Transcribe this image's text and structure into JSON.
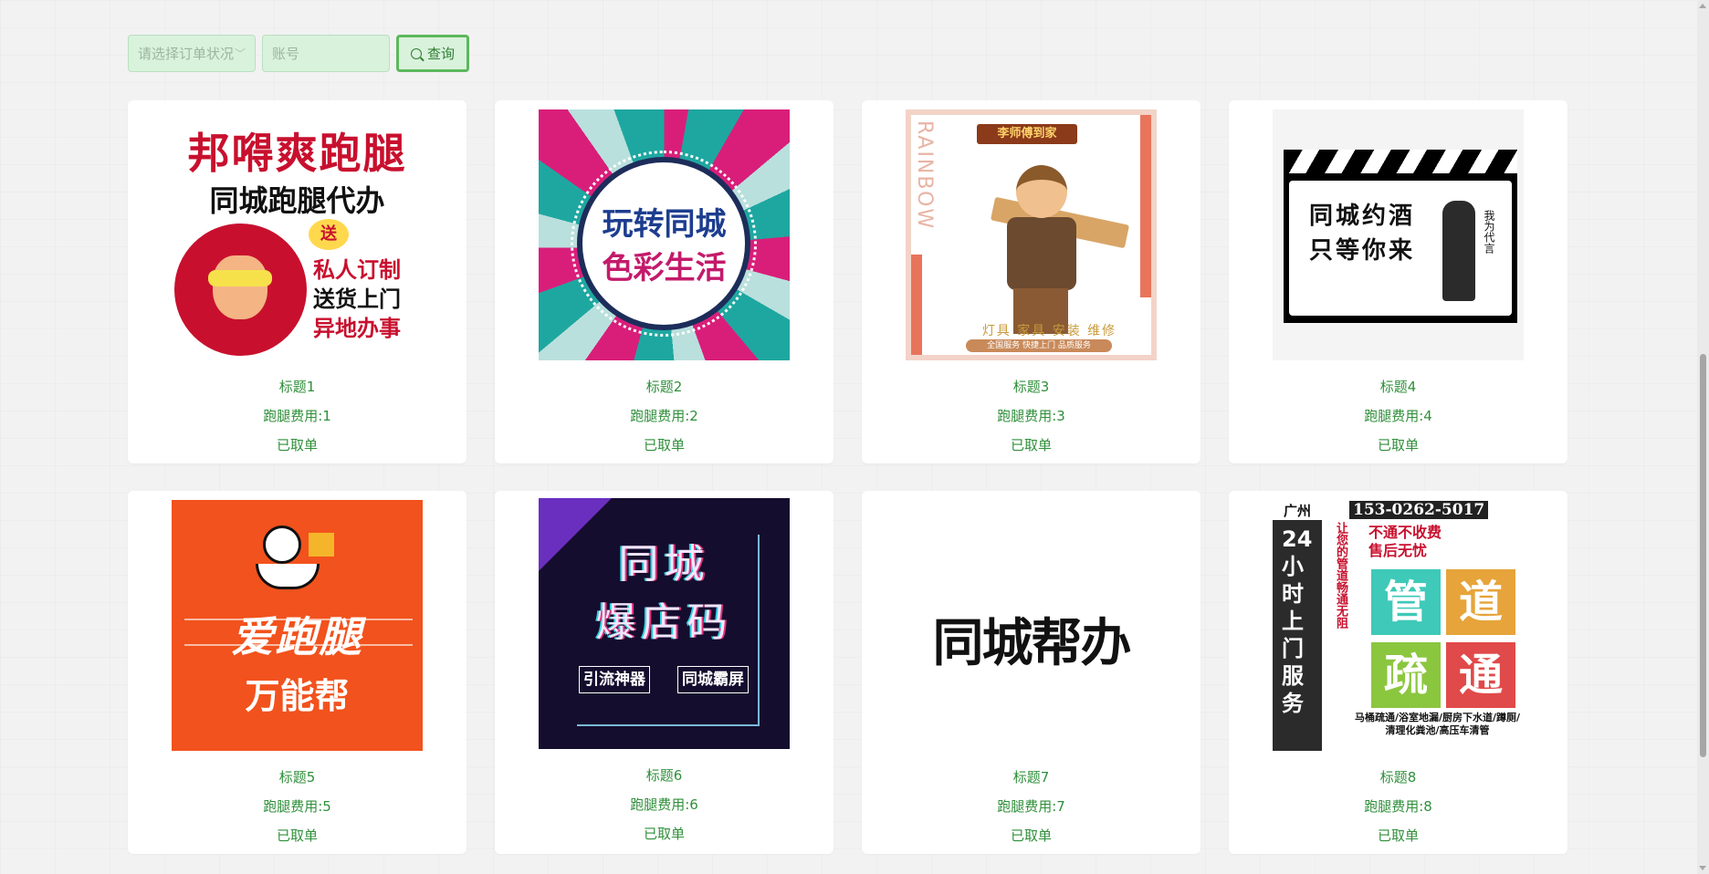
{
  "toolbar": {
    "status_placeholder": "请选择订单状况",
    "account_placeholder": "账号",
    "query_label": "查询"
  },
  "cards": [
    {
      "title": "标题1",
      "fee": "跑腿费用:1",
      "status": "已取单",
      "image_text": {
        "h1": "邦嘚爽跑腿",
        "h2": "同城跑腿代办",
        "badge": "送",
        "l1": "私人订制",
        "l2": "送货上门",
        "l3": "异地办事"
      }
    },
    {
      "title": "标题2",
      "fee": "跑腿费用:2",
      "status": "已取单",
      "image_text": {
        "l1": "玩转同城",
        "l2": "色彩生活"
      }
    },
    {
      "title": "标题3",
      "fee": "跑腿费用:3",
      "status": "已取单",
      "image_text": {
        "banner": "李师傅到家",
        "side": "RAINBOW",
        "caption": "灯具 家具 安装 维修",
        "sub": "全国服务 快捷上门 品质服务"
      }
    },
    {
      "title": "标题4",
      "fee": "跑腿费用:4",
      "status": "已取单",
      "image_text": {
        "l1": "同城约酒",
        "l2": "只等你来",
        "side": "我为代言"
      }
    },
    {
      "title": "标题5",
      "fee": "跑腿费用:5",
      "status": "已取单",
      "image_text": {
        "big": "爱跑腿",
        "small": "万能帮"
      }
    },
    {
      "title": "标题6",
      "fee": "跑腿费用:6",
      "status": "已取单",
      "image_text": {
        "l1": "同城",
        "l2": "爆店码",
        "tag1": "引流神器",
        "tag2": "同城霸屏"
      }
    },
    {
      "title": "标题7",
      "fee": "跑腿费用:7",
      "status": "已取单",
      "image_text": {
        "txt": "同城帮办"
      }
    },
    {
      "title": "标题8",
      "fee": "跑腿费用:8",
      "status": "已取单",
      "image_text": {
        "city": "广州",
        "phone": "153-0262-5017",
        "left": "24小时上门服务",
        "vstrip": "让您的管道畅通无阻",
        "red1": "不通不收费",
        "red2": "售后无忧",
        "t1": "管",
        "t2": "道",
        "t3": "疏",
        "t4": "通",
        "bottom": "马桶疏通/浴室地漏/厨房下水道/蹲厕/清理化粪池/高压车清管"
      }
    }
  ]
}
